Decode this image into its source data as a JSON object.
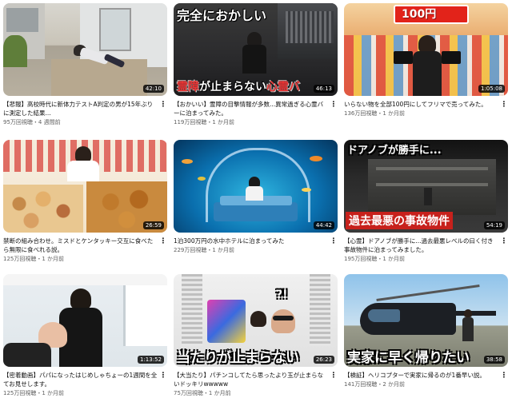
{
  "videos": [
    {
      "title": "【悲報】高校時代に新体力テストA判定の男が15年ぶりに測定した結果...",
      "views": "95万回視聴",
      "age": "4 週間前",
      "duration": "42:10",
      "overlay": ""
    },
    {
      "title": "【おかいい】霊障の目撃情報が多数...異常過ぎる心霊バーに泊まってみた。",
      "views": "119万回視聴",
      "age": "1 か月前",
      "duration": "46:13",
      "overlay_top": "完全におかしい",
      "overlay_bottom_a": "霊障",
      "overlay_bottom_b": "が止まらない",
      "overlay_bottom_c": "心霊バ"
    },
    {
      "title": "いらない物を全部100円にしてフリマで売ってみた。",
      "views": "136万回視聴",
      "age": "1 か月前",
      "duration": "1:05:08",
      "overlay": "100円"
    },
    {
      "title": "禁断の組み合わせ。ミスドとケンタッキー交互に食べたら無限に食べれる説。",
      "views": "125万回視聴",
      "age": "1 か月前",
      "duration": "26:59",
      "overlay": ""
    },
    {
      "title": "1泊300万円の水中ホテルに泊まってみた",
      "views": "229万回視聴",
      "age": "1 か月前",
      "duration": "44:42",
      "overlay": ""
    },
    {
      "title": "【心霊】ドアノブが勝手に...過去最悪レベルの曰く付き事故物件に泊まってみました。",
      "views": "195万回視聴",
      "age": "1 か月前",
      "duration": "54:19",
      "overlay_top": "ドアノブが勝手に...",
      "overlay_bottom": "過去最悪の事故物件"
    },
    {
      "title": "【密着動画】パパになったはじめしゃちょーの1週間を全てお見せします。",
      "views": "125万回視聴",
      "age": "1 か月前",
      "duration": "1:13:52",
      "overlay": ""
    },
    {
      "title": "【大当たり】パチンコしてたら思ったより玉が止まらないドッキリwwwww",
      "views": "75万回視聴",
      "age": "1 か月前",
      "duration": "26:23",
      "overlay": "当たりが止まらない",
      "overlay_small": "?!"
    },
    {
      "title": "【検証】ヘリコプターで実家に帰るのが1番早い説。",
      "views": "141万回視聴",
      "age": "2 か月前",
      "duration": "38:58",
      "overlay": "実家に早く帰りたい"
    }
  ],
  "separator": "・",
  "menu_icon": "vertical-ellipsis-icon"
}
